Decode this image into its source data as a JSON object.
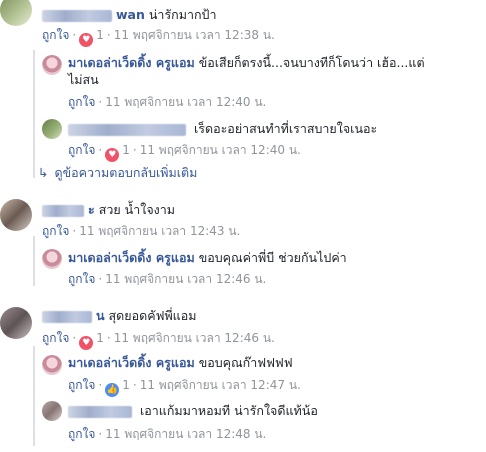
{
  "comments": [
    {
      "text": "น่ารักมากป้า",
      "name_visible": "wan",
      "like_label": "ถูกใจ",
      "reaction_count": "1",
      "timestamp": "11 พฤศจิกายน เวลา 12:38 น."
    },
    {
      "name": "มาเดอล่าเว็ดดิ้ง ครูแอม",
      "text_line1": "ข้อเสียก็ตรงนี้...จนบางทีก็โดนว่า เฮ้อ...แต่",
      "text_line2": "ไม่สน",
      "like_label": "ถูกใจ",
      "timestamp": "11 พฤศจิกายน เวลา 12:40 น."
    },
    {
      "text": "เร็ดอะอย่าสนทำที่เราสบายใจเนอะ",
      "like_label": "ถูกใจ",
      "reaction_count": "1",
      "timestamp": "11 พฤศจิกายน เวลา 12:40 น."
    },
    {
      "more_replies": "ดูข้อความตอบกลับเพิ่มเติม"
    },
    {
      "name_visible": "ะ",
      "text": "สวย น้ำใจงาม",
      "like_label": "ถูกใจ",
      "timestamp": "11 พฤศจิกายน เวลา 12:43 น."
    },
    {
      "name": "มาเดอล่าเว็ดดิ้ง ครูแอม",
      "text": "ขอบคุณค่าพี่บี ช่วยกันไปค่า",
      "like_label": "ถูกใจ",
      "timestamp": "11 พฤศจิกายน เวลา 12:46 น."
    },
    {
      "name_visible": "น",
      "text": "สุดยอดคัฟพี่แอม",
      "like_label": "ถูกใจ",
      "reaction_count": "1",
      "timestamp": "11 พฤศจิกายน เวลา 12:46 น."
    },
    {
      "name": "มาเดอล่าเว็ดดิ้ง ครูแอม",
      "text": "ขอบคุณก๊าฟฟฟฟ",
      "like_label": "ถูกใจ",
      "reaction_count": "1",
      "timestamp": "11 พฤศจิกายน เวลา 12:47 น."
    },
    {
      "text": "เอาแก้มมาหอมที น่ารักใจดีแท้น้อ",
      "like_label": "ถูกใจ",
      "timestamp": "11 พฤศจิกายน เวลา 12:48 น."
    }
  ],
  "colors": {
    "link": "#385898",
    "meta": "#90949c",
    "heart": "#f25268",
    "like_blue": "#4e8cf5",
    "thread_line": "#dddfe2"
  },
  "icons": {
    "heart": "heart-reaction-icon",
    "thumb": "like-reaction-icon",
    "reply_arrow": "reply-arrow-icon"
  }
}
